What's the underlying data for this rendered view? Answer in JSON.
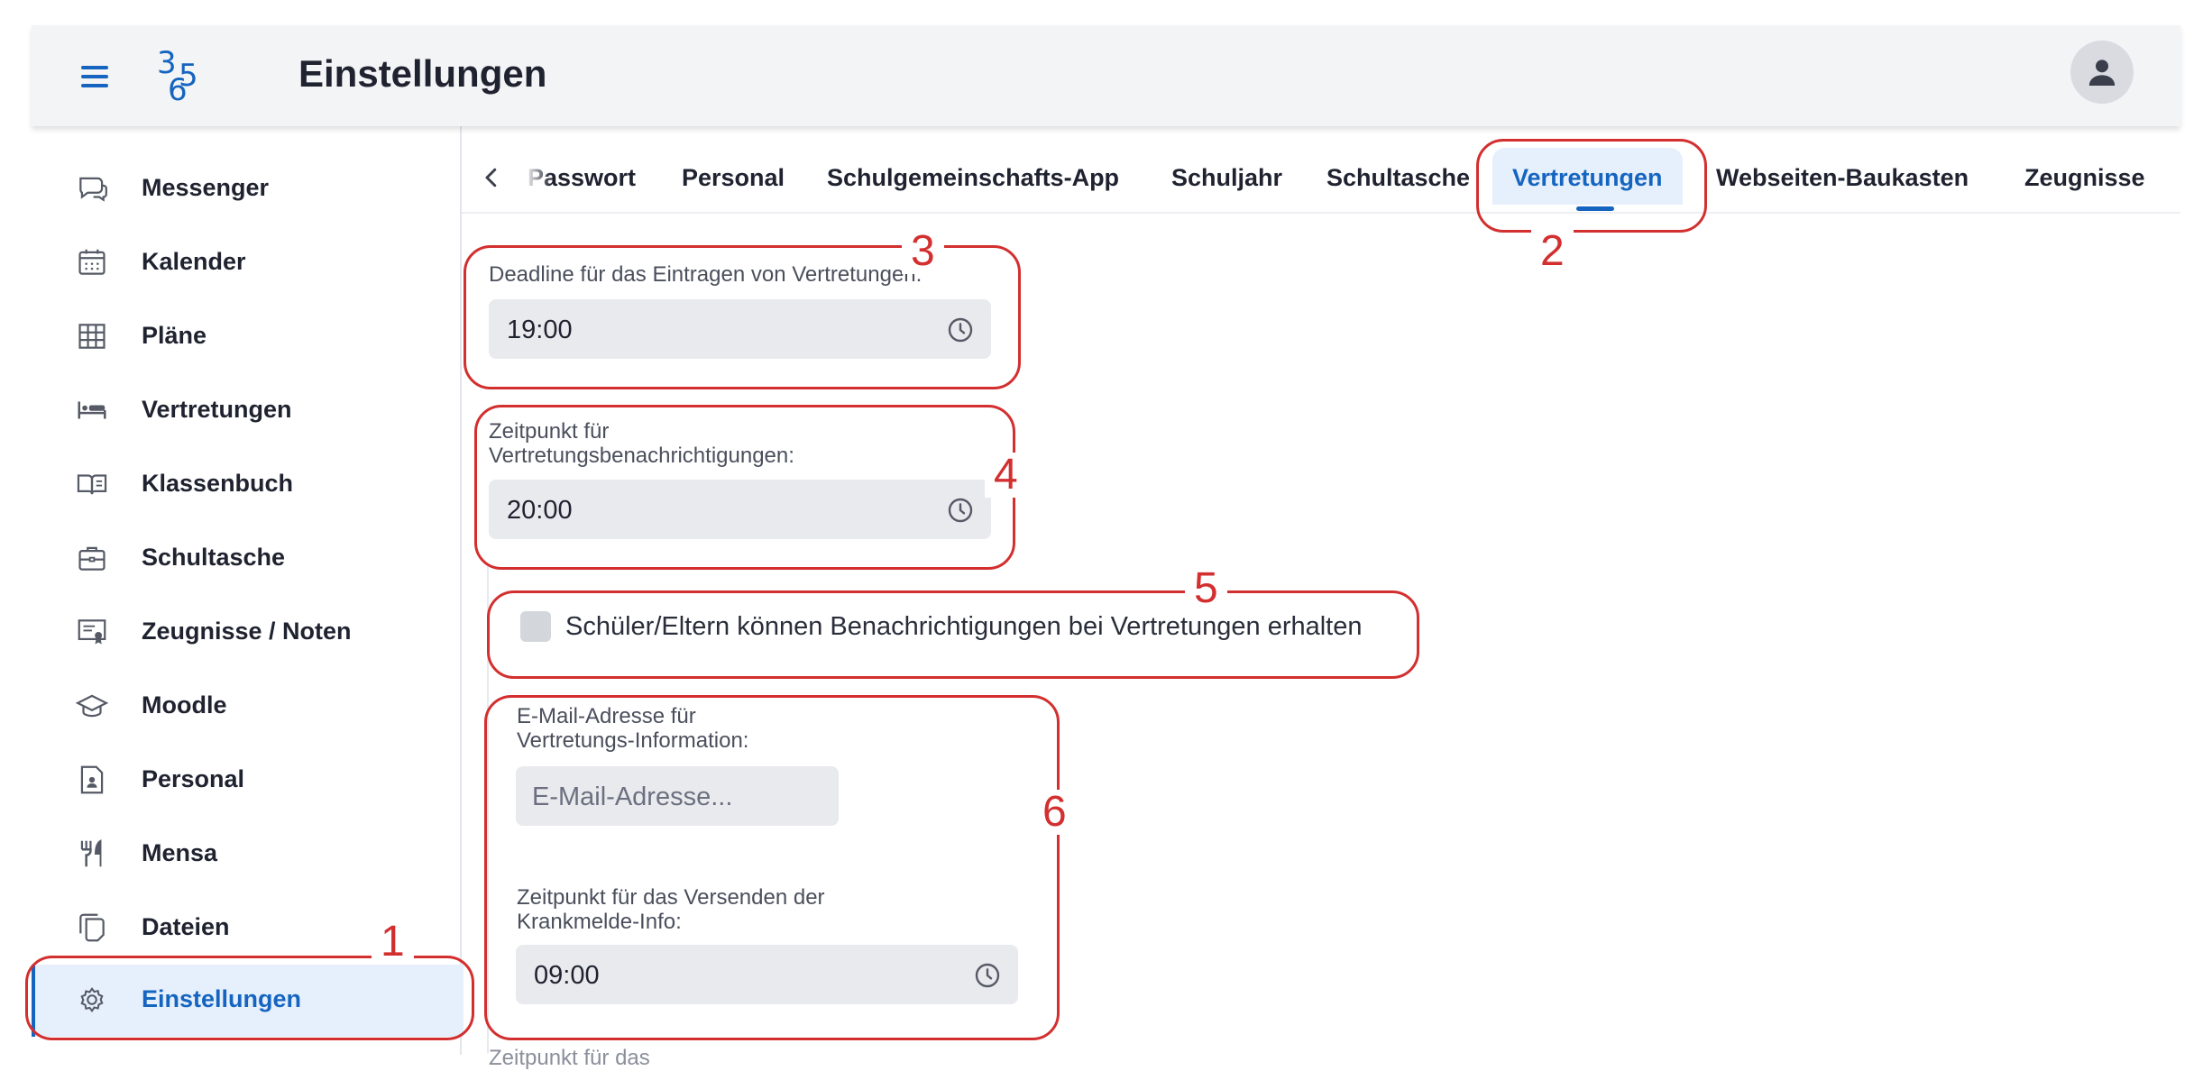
{
  "header": {
    "title": "Einstellungen",
    "logo": {
      "d3": "3",
      "d5": "5",
      "d6": "6"
    }
  },
  "sidebar": {
    "items": [
      {
        "label": "Messenger",
        "icon": "chat-icon"
      },
      {
        "label": "Kalender",
        "icon": "calendar-icon"
      },
      {
        "label": "Pläne",
        "icon": "grid-icon"
      },
      {
        "label": "Vertretungen",
        "icon": "bed-icon"
      },
      {
        "label": "Klassenbuch",
        "icon": "book-icon"
      },
      {
        "label": "Schultasche",
        "icon": "briefcase-icon"
      },
      {
        "label": "Zeugnisse / Noten",
        "icon": "certificate-icon"
      },
      {
        "label": "Moodle",
        "icon": "graduation-cap-icon"
      },
      {
        "label": "Personal",
        "icon": "person-file-icon"
      },
      {
        "label": "Mensa",
        "icon": "cutlery-icon"
      },
      {
        "label": "Dateien",
        "icon": "files-icon"
      },
      {
        "label": "Einstellungen",
        "icon": "gear-icon",
        "active": true
      }
    ]
  },
  "tabs": [
    {
      "label": "Passwort"
    },
    {
      "label": "Personal"
    },
    {
      "label": "Schulgemeinschafts-App"
    },
    {
      "label": "Schuljahr"
    },
    {
      "label": "Schultasche"
    },
    {
      "label": "Vertretungen",
      "active": true
    },
    {
      "label": "Webseiten-Baukasten"
    },
    {
      "label": "Zeugnisse"
    }
  ],
  "form": {
    "deadline": {
      "label": "Deadline für das Eintragen von Vertretungen:",
      "value": "19:00"
    },
    "notify_time": {
      "label_line1": "Zeitpunkt für",
      "label_line2": "Vertretungsbenachrichtigungen:",
      "value": "20:00"
    },
    "checkbox": {
      "label": "Schüler/Eltern können Benachrichtigungen bei Vertretungen erhalten",
      "checked": false
    },
    "email": {
      "label_line1": "E-Mail-Adresse für",
      "label_line2": "Vertretungs-Information:",
      "placeholder": "E-Mail-Adresse..."
    },
    "sick_time": {
      "label_line1": "Zeitpunkt für das Versenden der",
      "label_line2": "Krankmelde-Info:",
      "value": "09:00"
    },
    "partial_label": "Zeitpunkt für das"
  },
  "annotations": [
    "1",
    "2",
    "3",
    "4",
    "5",
    "6"
  ],
  "colors": {
    "accent": "#1565c0",
    "annotation": "#d32f2f",
    "field": "#e8eaed",
    "active_bg": "#e6effc"
  }
}
